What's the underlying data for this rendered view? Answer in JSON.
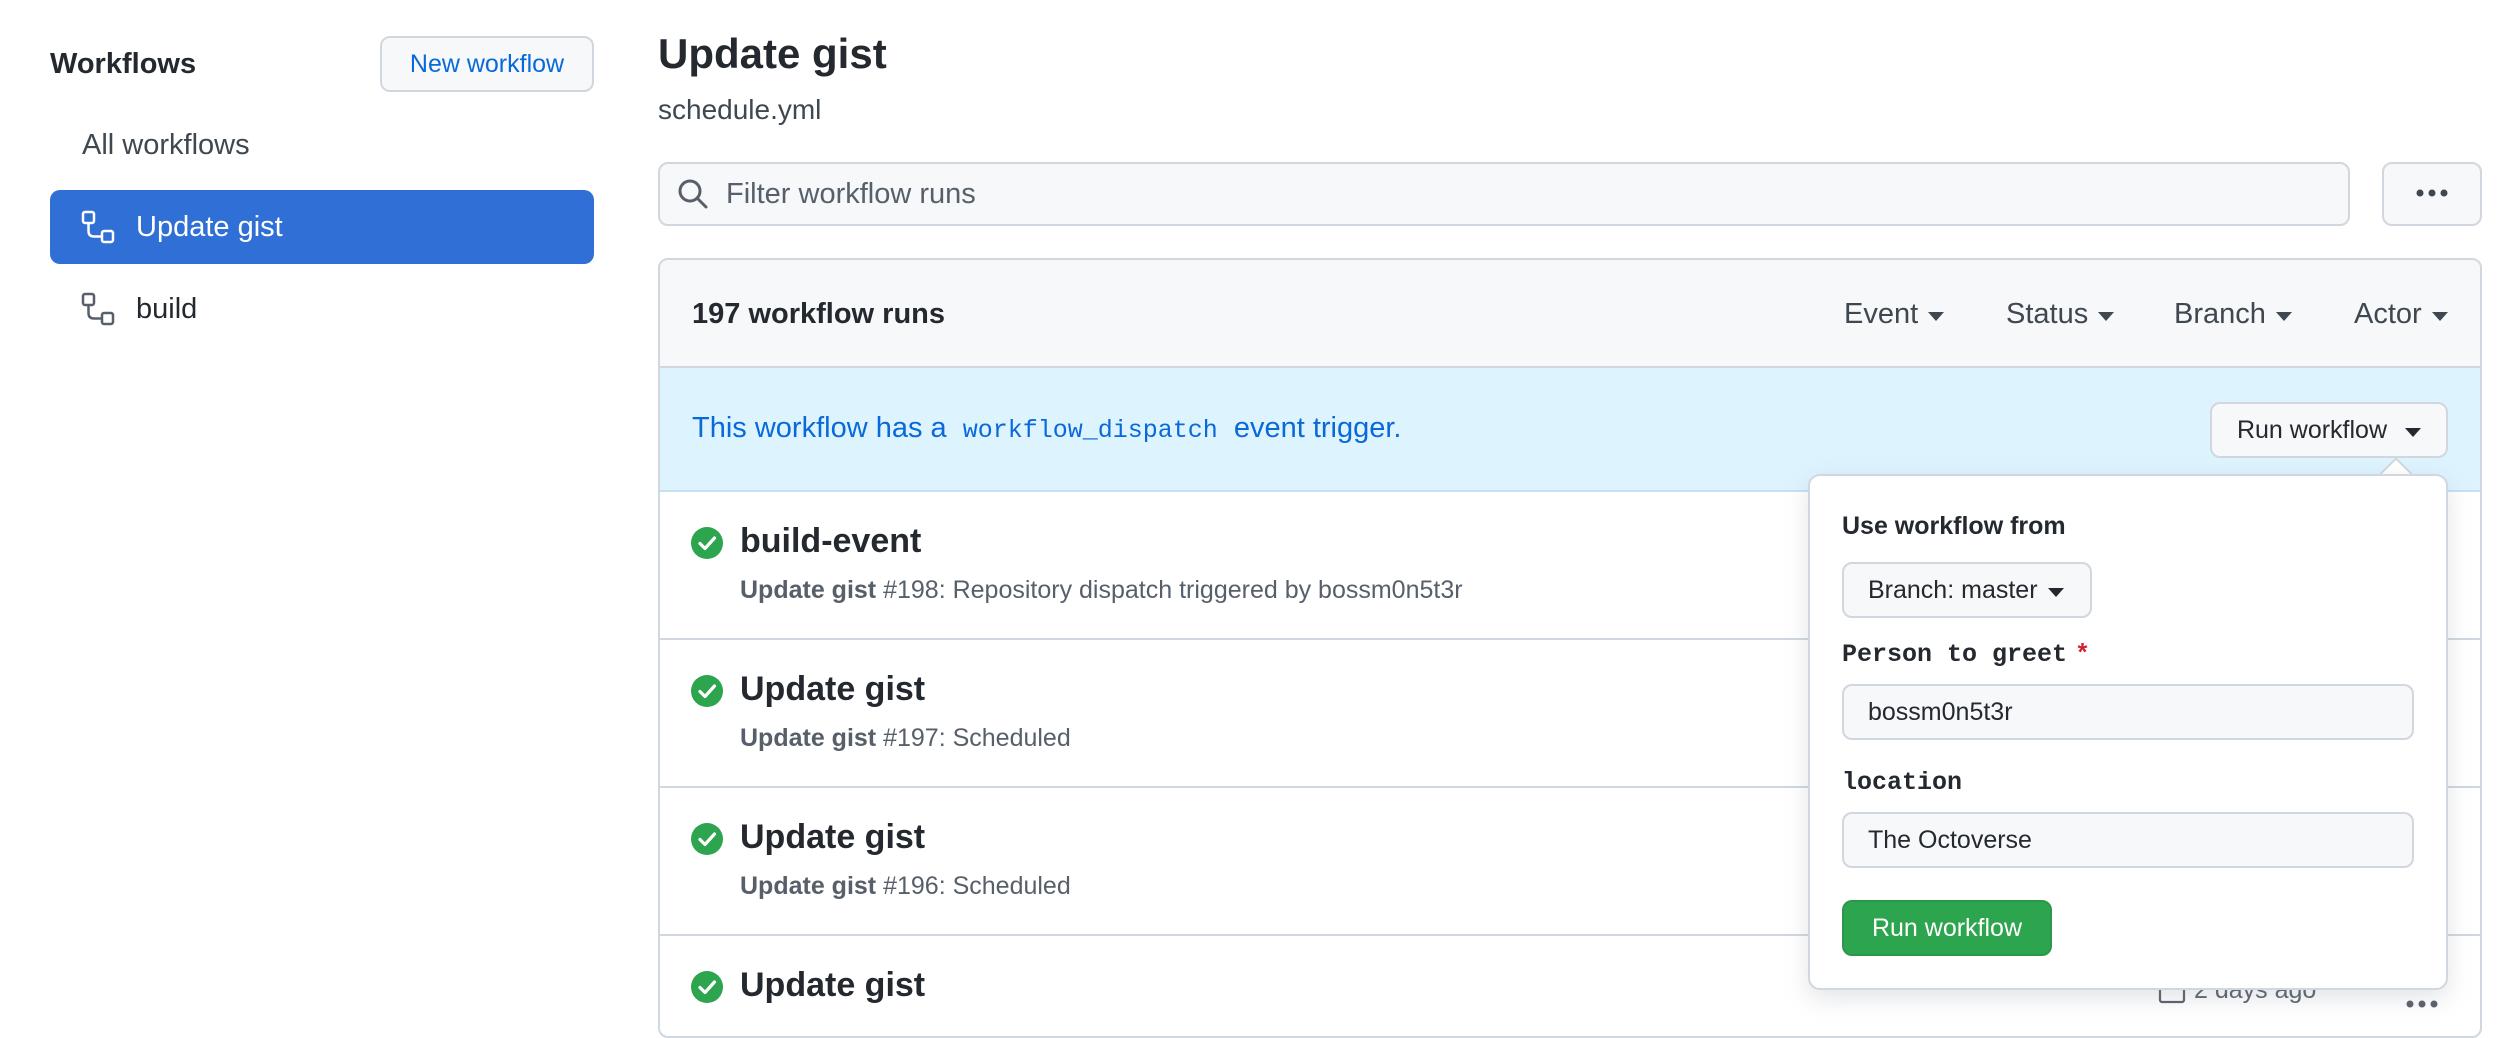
{
  "sidebar": {
    "title": "Workflows",
    "new_workflow_label": "New workflow",
    "items": [
      {
        "label": "All workflows",
        "active": false
      },
      {
        "label": "Update gist",
        "active": true,
        "icon": "workflow-icon"
      },
      {
        "label": "build",
        "active": false,
        "icon": "workflow-icon"
      }
    ]
  },
  "header": {
    "title": "Update gist",
    "subtitle": "schedule.yml"
  },
  "filter": {
    "placeholder": "Filter workflow runs",
    "icon": "search-icon",
    "more_icon": "kebab-icon"
  },
  "runs": {
    "count_label": "197 workflow runs",
    "filters": [
      "Event",
      "Status",
      "Branch",
      "Actor"
    ],
    "dispatch": {
      "text_before": "This workflow has a",
      "code": "workflow_dispatch",
      "text_after": "event trigger.",
      "run_button_label": "Run workflow"
    },
    "items": [
      {
        "title": "build-event",
        "prefix": "Update gist",
        "detail": "#198: Repository dispatch triggered by bossm0n5t3r",
        "status": "success"
      },
      {
        "title": "Update gist",
        "prefix": "Update gist",
        "detail": "#197: Scheduled",
        "status": "success"
      },
      {
        "title": "Update gist",
        "prefix": "Update gist",
        "detail": "#196: Scheduled",
        "status": "success"
      },
      {
        "title": "Update gist",
        "prefix": "",
        "detail": "",
        "status": "success",
        "time": "2 days ago"
      }
    ]
  },
  "dispatch_form": {
    "use_from_label": "Use workflow from",
    "branch_prefix": "Branch:",
    "branch_value": "master",
    "inputs": [
      {
        "label": "Person to greet",
        "required": true,
        "value": "bossm0n5t3r"
      },
      {
        "label": "location",
        "required": false,
        "value": "The Octoverse"
      }
    ],
    "submit_label": "Run workflow"
  },
  "colors": {
    "accent": "#2f6fd6",
    "link": "#0969da",
    "success": "#2da44e",
    "banner": "#ddf4ff"
  }
}
